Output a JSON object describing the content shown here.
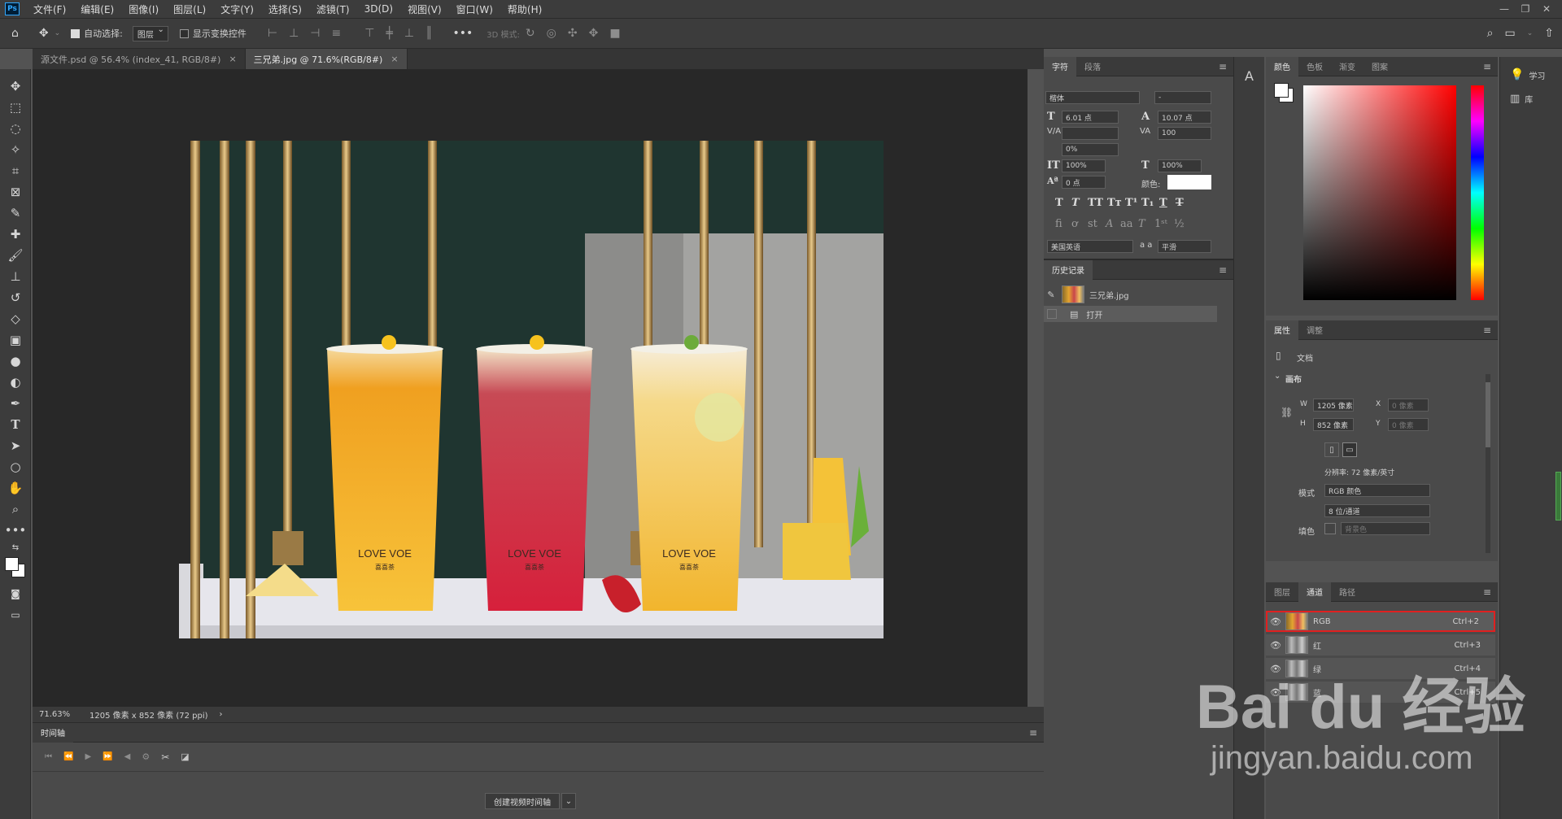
{
  "app": {
    "logo": "Ps"
  },
  "menu": [
    "文件(F)",
    "编辑(E)",
    "图像(I)",
    "图层(L)",
    "文字(Y)",
    "选择(S)",
    "滤镜(T)",
    "3D(D)",
    "视图(V)",
    "窗口(W)",
    "帮助(H)"
  ],
  "window_controls": [
    "—",
    "❐",
    "✕"
  ],
  "options": {
    "auto_select_label": "自动选择:",
    "auto_select_target": "图层",
    "show_transform_label": "显示变换控件",
    "mode_3d_label": "3D 模式:"
  },
  "tabs": [
    {
      "label": "源文件.psd @ 56.4% (index_41, RGB/8#)",
      "active": false
    },
    {
      "label": "三兄弟.jpg @ 71.6%(RGB/8#)",
      "active": true
    }
  ],
  "status": {
    "zoom": "71.63%",
    "info": "1205 像素 x 852 像素 (72 ppi)"
  },
  "timeline": {
    "title": "时间轴",
    "create_button": "创建视频时间轴"
  },
  "character_panel": {
    "tabs": [
      "字符",
      "段落"
    ],
    "font_family": "楷体",
    "font_style": "-",
    "size": "6.01 点",
    "leading": "10.07 点",
    "kerning": "",
    "tracking": "100",
    "tsume": "0%",
    "vscale": "100%",
    "hscale": "100%",
    "baseline": "0 点",
    "color_label": "颜色:",
    "language": "美国英语",
    "aa_label": "a a",
    "antialias": "平滑"
  },
  "history_panel": {
    "title": "历史记录",
    "snapshot": "三兄弟.jpg",
    "items": [
      "打开"
    ]
  },
  "color_panel": {
    "tabs": [
      "颜色",
      "色板",
      "渐变",
      "图案"
    ]
  },
  "learn_panel": {
    "items": [
      "学习",
      "库"
    ]
  },
  "properties_panel": {
    "tabs": [
      "属性",
      "调整"
    ],
    "doc_label": "文档",
    "canvas_label": "画布",
    "w_label": "W",
    "w_value": "1205 像素",
    "h_label": "H",
    "h_value": "852 像素",
    "x_label": "X",
    "x_placeholder": "0 像素",
    "y_label": "Y",
    "y_placeholder": "0 像素",
    "resolution": "分辨率: 72 像素/英寸",
    "mode_label": "模式",
    "mode_value": "RGB 颜色",
    "depth_value": "8 位/通道",
    "fill_label": "填色",
    "fill_value": "背景色"
  },
  "channels_panel": {
    "tabs": [
      "图层",
      "通道",
      "路径"
    ],
    "channels": [
      {
        "name": "RGB",
        "shortcut": "Ctrl+2"
      },
      {
        "name": "红",
        "shortcut": "Ctrl+3"
      },
      {
        "name": "绿",
        "shortcut": "Ctrl+4"
      },
      {
        "name": "蓝",
        "shortcut": "Ctrl+5"
      }
    ]
  },
  "watermark": {
    "brand": "Bai du 经验",
    "url": "jingyan.baidu.com"
  },
  "photo": {
    "cup_logo": "LOVE VOE",
    "cup_sub": "喜喜茶"
  }
}
